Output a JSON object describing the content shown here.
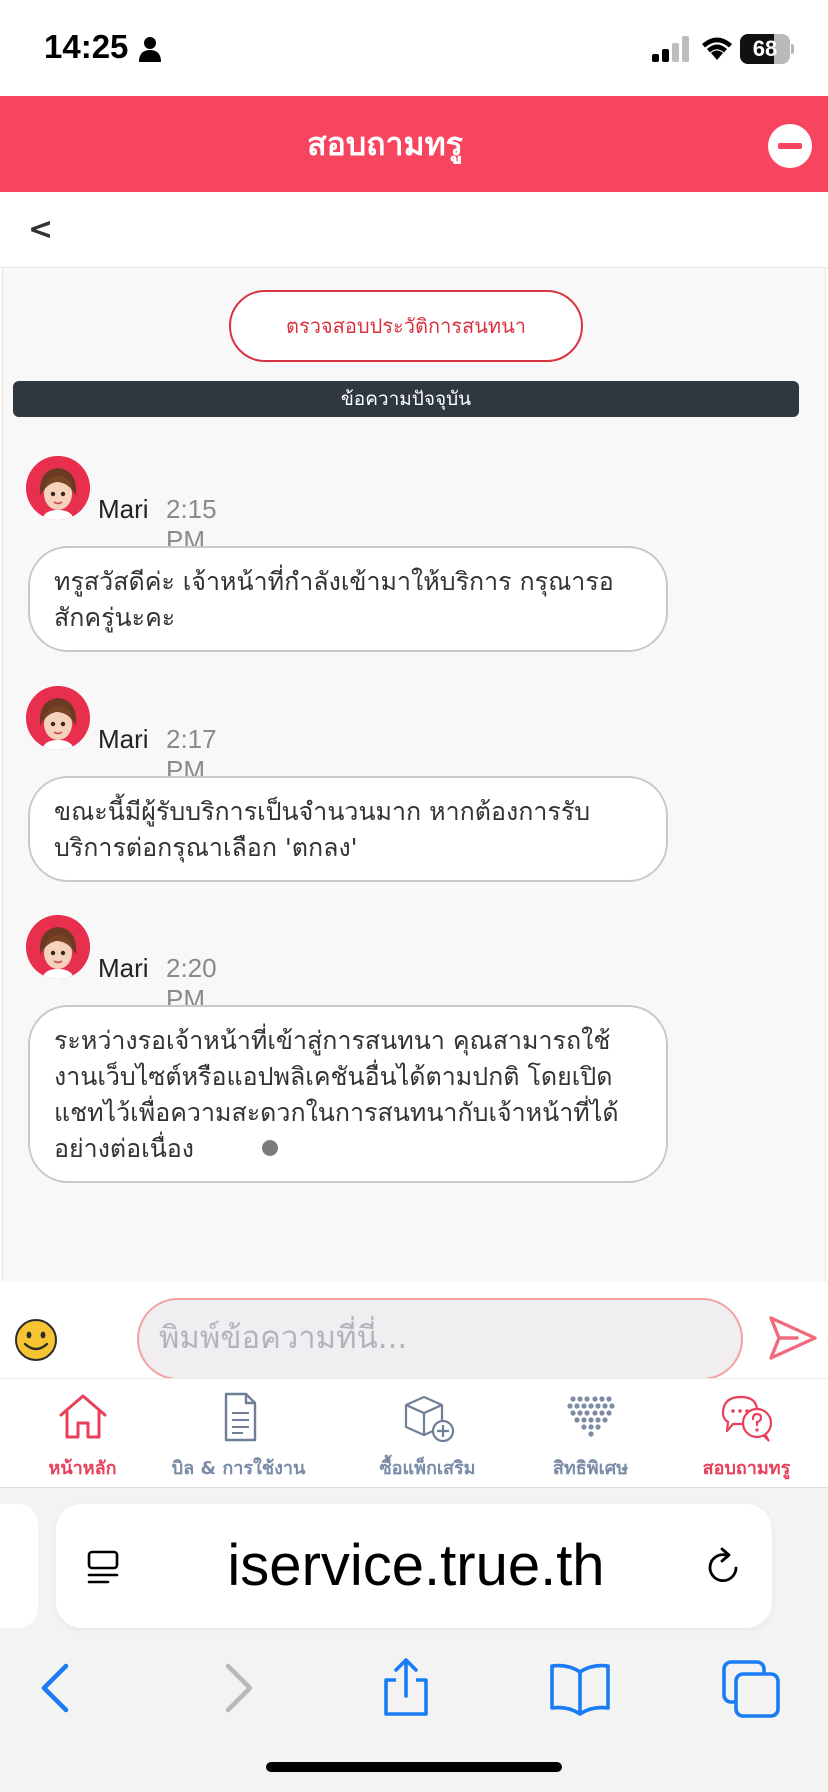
{
  "status_bar": {
    "time": "14:25",
    "battery": "68",
    "battery_level": 0.68,
    "icons": [
      "person-icon",
      "signal-icon",
      "wifi-icon",
      "battery-icon"
    ]
  },
  "header": {
    "title": "สอบถามทรู",
    "minimize_icon": "minus-circle-icon"
  },
  "back": {
    "label": "<"
  },
  "chat": {
    "history_button": "ตรวจสอบประวัติการสนทนา",
    "current_label": "ข้อความปัจจุบัน",
    "messages": [
      {
        "sender": "Mari",
        "time": "2:15 PM",
        "text": "ทรูสวัสดีค่ะ เจ้าหน้าที่กำลังเข้ามาให้บริการ กรุณารอสักครู่นะคะ"
      },
      {
        "sender": "Mari",
        "time": "2:17 PM",
        "text": "ขณะนี้มีผู้รับบริการเป็นจำนวนมาก หากต้องการรับบริการต่อกรุณาเลือก 'ตกลง'"
      },
      {
        "sender": "Mari",
        "time": "2:20 PM",
        "text": "ระหว่างรอเจ้าหน้าที่เข้าสู่การสนทนา คุณสามารถใช้งานเว็บไซต์หรือแอปพลิเคชันอื่นได้ตามปกติ โดยเปิดแชทไว้เพื่อความสะดวกในการสนทนากับเจ้าหน้าที่ได้อย่างต่อเนื่อง"
      }
    ]
  },
  "input": {
    "placeholder": "พิมพ์ข้อความที่นี่...",
    "emoji_icon": "emoji-icon",
    "send_icon": "send-icon"
  },
  "nav": {
    "items": [
      {
        "label": "หน้าหลัก",
        "icon": "home-icon"
      },
      {
        "label": "บิล & การใช้งาน",
        "icon": "bill-icon"
      },
      {
        "label": "ซื้อแพ็กเสริม",
        "icon": "package-add-icon"
      },
      {
        "label": "สิทธิพิเศษ",
        "icon": "heart-dots-icon"
      },
      {
        "label": "สอบถามทรู",
        "icon": "chat-help-icon"
      }
    ]
  },
  "browser": {
    "url": "iservice.true.th",
    "icons": [
      "reader-icon",
      "reload-icon",
      "back-arrow-icon",
      "forward-arrow-icon",
      "share-icon",
      "bookmarks-icon",
      "tabs-icon"
    ]
  },
  "colors": {
    "brand": "#f7445f",
    "accent_red": "#d93340",
    "dark_bar": "#2f3740",
    "ios_blue": "#1a7cf5"
  }
}
